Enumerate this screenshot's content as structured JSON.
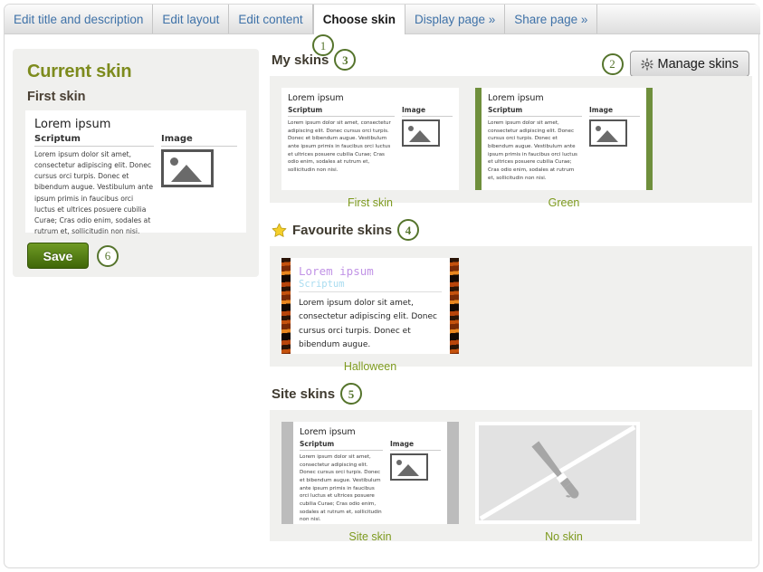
{
  "tabs": [
    {
      "label": "Edit title and description",
      "active": false
    },
    {
      "label": "Edit layout",
      "active": false
    },
    {
      "label": "Edit content",
      "active": false
    },
    {
      "label": "Choose skin",
      "active": true
    },
    {
      "label": "Display page »",
      "active": false
    },
    {
      "label": "Share page »",
      "active": false
    }
  ],
  "badges": {
    "tab": "1",
    "manage": "2",
    "my_skins": "3",
    "favourite_skins": "4",
    "site_skins": "5",
    "save": "6"
  },
  "current_skin": {
    "title": "Current skin",
    "name": "First skin",
    "save_label": "Save"
  },
  "toolbar": {
    "manage_label": "Manage skins",
    "gear_icon": "gear-icon"
  },
  "sections": {
    "my_skins": {
      "heading": "My skins",
      "cards": [
        {
          "caption": "First skin",
          "variant": "plain"
        },
        {
          "caption": "Green",
          "variant": "green"
        }
      ]
    },
    "favourite_skins": {
      "heading": "Favourite skins",
      "star_icon": "star-icon",
      "cards": [
        {
          "caption": "Halloween",
          "variant": "halloween"
        }
      ]
    },
    "site_skins": {
      "heading": "Site skins",
      "cards": [
        {
          "caption": "Site skin",
          "variant": "gray"
        },
        {
          "caption": "No skin",
          "variant": "none"
        }
      ]
    }
  },
  "skin_preview": {
    "title": "Lorem ipsum",
    "col_left_heading": "Scriptum",
    "col_right_heading": "Image",
    "body": "Lorem ipsum dolor sit amet, consectetur adipiscing elit. Donec cursus orci turpis. Donec et bibendum augue. Vestibulum ante ipsum primis in faucibus orci luctus et ultrices posuere cubilia Curae; Cras odio enim, sodales at rutrum et, sollicitudin non nisi."
  },
  "halloween_preview": {
    "title": "Lorem ipsum",
    "subtitle": "Scriptum",
    "body": "Lorem ipsum dolor sit amet, consectetur adipiscing elit. Donec cursus orci turpis. Donec et bibendum augue."
  },
  "colors": {
    "accent_green": "#7d9a1e",
    "badge_green": "#55742c",
    "tab_link": "#3f72a8",
    "panel_bg": "#f0f0ee",
    "save_green": "#4d7a10"
  }
}
